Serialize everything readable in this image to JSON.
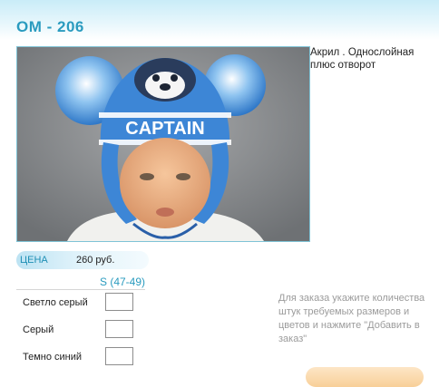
{
  "product": {
    "title": "ОМ - 206",
    "description": "Акрил . Однослойная плюс отворот",
    "photo_text": "CAPTAIN"
  },
  "price": {
    "label": "ЦЕНА",
    "value": "260 руб."
  },
  "size_header": "S (47-49)",
  "colors": [
    {
      "label": "Светло серый",
      "quantity": ""
    },
    {
      "label": "Серый",
      "quantity": ""
    },
    {
      "label": "Темно синий",
      "quantity": ""
    }
  ],
  "order_note": "Для заказа укажите количества штук требуемых размеров и цветов и нажмите \"Добавить в заказ\"",
  "theme": {
    "accent": "#2a9bbf",
    "note_color": "#9b9b9b",
    "button_color": "#f8cf98"
  }
}
